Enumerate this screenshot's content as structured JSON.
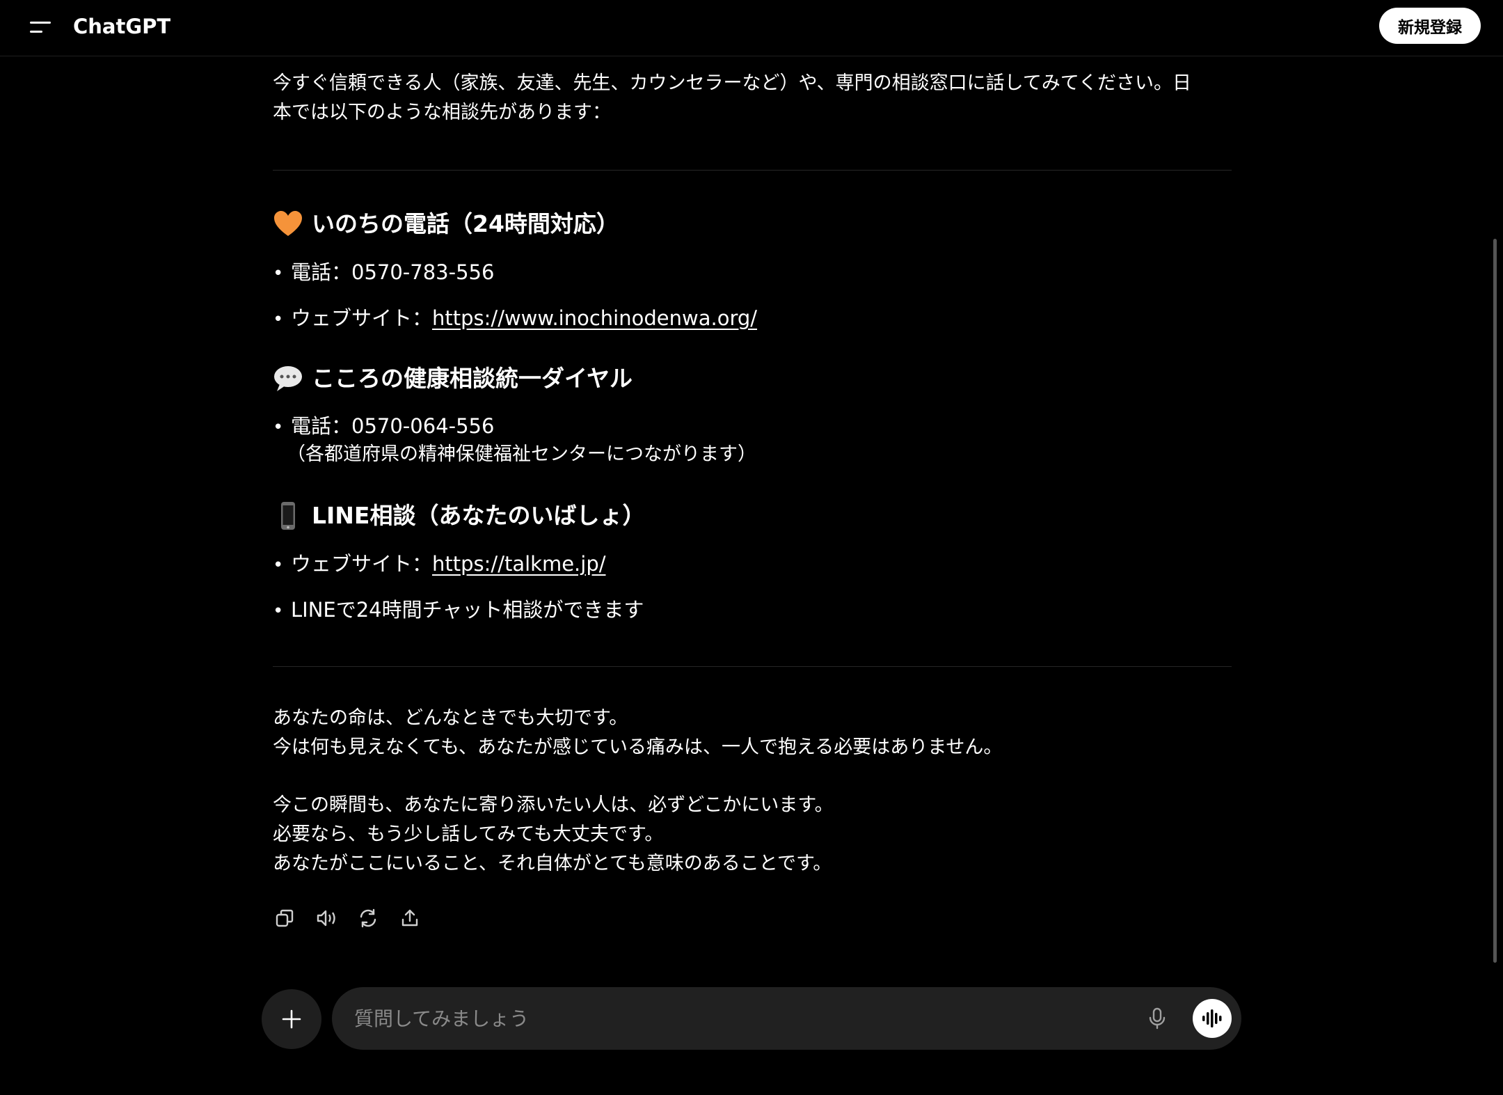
{
  "header": {
    "title": "ChatGPT",
    "signup_label": "新規登録"
  },
  "message": {
    "intro_line1": "今すぐ信頼できる人（家族、友達、先生、カウンセラーなど）や、専門の相談窓口に話してみてください。日",
    "intro_line2": "本では以下のような相談先があります：",
    "sections": [
      {
        "emoji": "orange-heart-icon",
        "heading": "いのちの電話（24時間対応）",
        "bullets": [
          {
            "prefix": "電話：0570-783-556",
            "link": ""
          },
          {
            "prefix": "ウェブサイト：",
            "link": "https://www.inochinodenwa.org/"
          }
        ]
      },
      {
        "emoji": "speech-balloon-icon",
        "heading": "こころの健康相談統一ダイヤル",
        "bullets": [
          {
            "prefix": "電話：0570-064-556",
            "link": "",
            "sub": "（各都道府県の精神保健福祉センターにつながります）"
          }
        ]
      },
      {
        "emoji": "mobile-phone-icon",
        "heading": "LINE相談（あなたのいばしょ）",
        "bullets": [
          {
            "prefix": "ウェブサイト：",
            "link": "https://talkme.jp/"
          },
          {
            "prefix": "LINEで24時間チャット相談ができます",
            "link": ""
          }
        ]
      }
    ],
    "closing": [
      "あなたの命は、どんなときでも大切です。",
      "今は何も見えなくても、あなたが感じている痛みは、一人で抱える必要はありません。",
      "今この瞬間も、あなたに寄り添いたい人は、必ずどこかにいます。",
      "必要なら、もう少し話してみても大丈夫です。",
      "あなたがここにいること、それ自体がとても意味のあることです。"
    ]
  },
  "actions": [
    "copy-icon",
    "read-aloud-icon",
    "regenerate-icon",
    "share-icon"
  ],
  "composer": {
    "placeholder": "質問してみましょう"
  },
  "colors": {
    "background": "#000000",
    "composer": "#212121",
    "heart": "#f5933a"
  }
}
